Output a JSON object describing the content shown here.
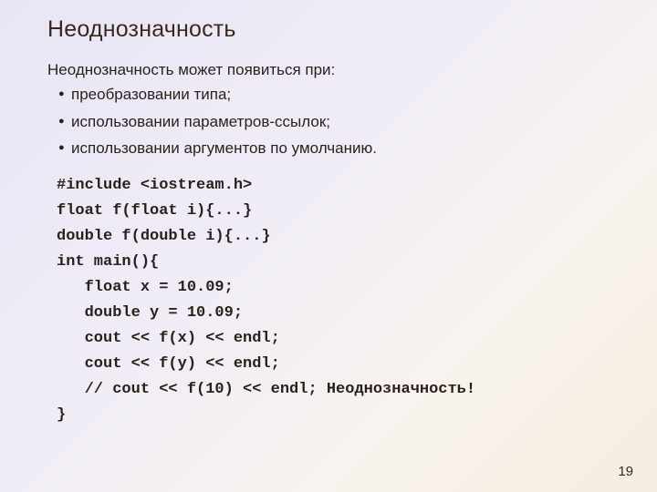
{
  "title": "Неоднозначность",
  "intro": "Неоднозначность может появиться при:",
  "bullets": [
    "преобразовании типа;",
    "использовании параметров-ссылок;",
    "использовании аргументов по умолчанию."
  ],
  "code": {
    "l1": "#include <iostream.h>",
    "l2": "float f(float i){...}",
    "l3": "double f(double i){...}",
    "l4": "int main(){",
    "l5": "   float x = 10.09;",
    "l6": "   double y = 10.09;",
    "l7": "   cout << f(x) << endl;",
    "l8": "   cout << f(y) << endl;",
    "l9": "   // cout << f(10) << endl; Неоднозначность!",
    "l10": "}"
  },
  "page_number": "19"
}
